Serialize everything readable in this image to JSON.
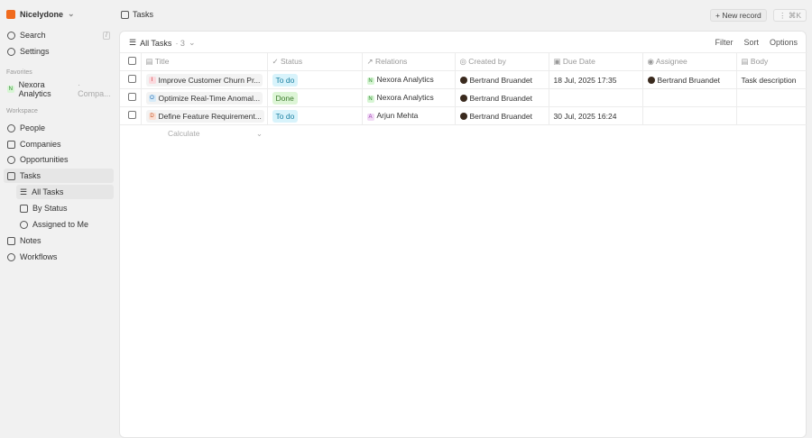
{
  "workspace": {
    "name": "Nicelydone"
  },
  "sidebar": {
    "search": "Search",
    "search_kbd": "/",
    "settings": "Settings",
    "favorites_label": "Favorites",
    "favorite": {
      "initial": "N",
      "name": "Nexora Analytics",
      "type": "· Compa..."
    },
    "workspace_label": "Workspace",
    "items": [
      {
        "label": "People"
      },
      {
        "label": "Companies"
      },
      {
        "label": "Opportunities"
      },
      {
        "label": "Tasks"
      }
    ],
    "task_views": [
      {
        "label": "All Tasks"
      },
      {
        "label": "By Status"
      },
      {
        "label": "Assigned to Me"
      }
    ],
    "more": [
      {
        "label": "Notes"
      },
      {
        "label": "Workflows"
      }
    ]
  },
  "header": {
    "title": "Tasks",
    "new_record": "+ New record",
    "more": "⋮ ⌘K"
  },
  "view": {
    "name": "All Tasks",
    "count": "· 3",
    "filter": "Filter",
    "sort": "Sort",
    "options": "Options"
  },
  "columns": [
    "Title",
    "Status",
    "Relations",
    "Created by",
    "Due Date",
    "Assignee",
    "Body"
  ],
  "rows": [
    {
      "initial": "I",
      "title": "Improve Customer Churn Pr...",
      "status": "To do",
      "rel_initial": "N",
      "relation": "Nexora Analytics",
      "created_by": "Bertrand Bruandet",
      "due": "18 Jul, 2025 17:35",
      "assignee": "Bertrand Bruandet",
      "body": "Task description"
    },
    {
      "initial": "O",
      "title": "Optimize Real-Time Anomal...",
      "status": "Done",
      "rel_initial": "N",
      "relation": "Nexora Analytics",
      "created_by": "Bertrand Bruandet",
      "due": "",
      "assignee": "",
      "body": ""
    },
    {
      "initial": "D",
      "title": "Define Feature Requirement...",
      "status": "To do",
      "rel_initial": "A",
      "relation": "Arjun Mehta",
      "created_by": "Bertrand Bruandet",
      "due": "30 Jul, 2025 16:24",
      "assignee": "",
      "body": ""
    }
  ],
  "calculate": "Calculate"
}
